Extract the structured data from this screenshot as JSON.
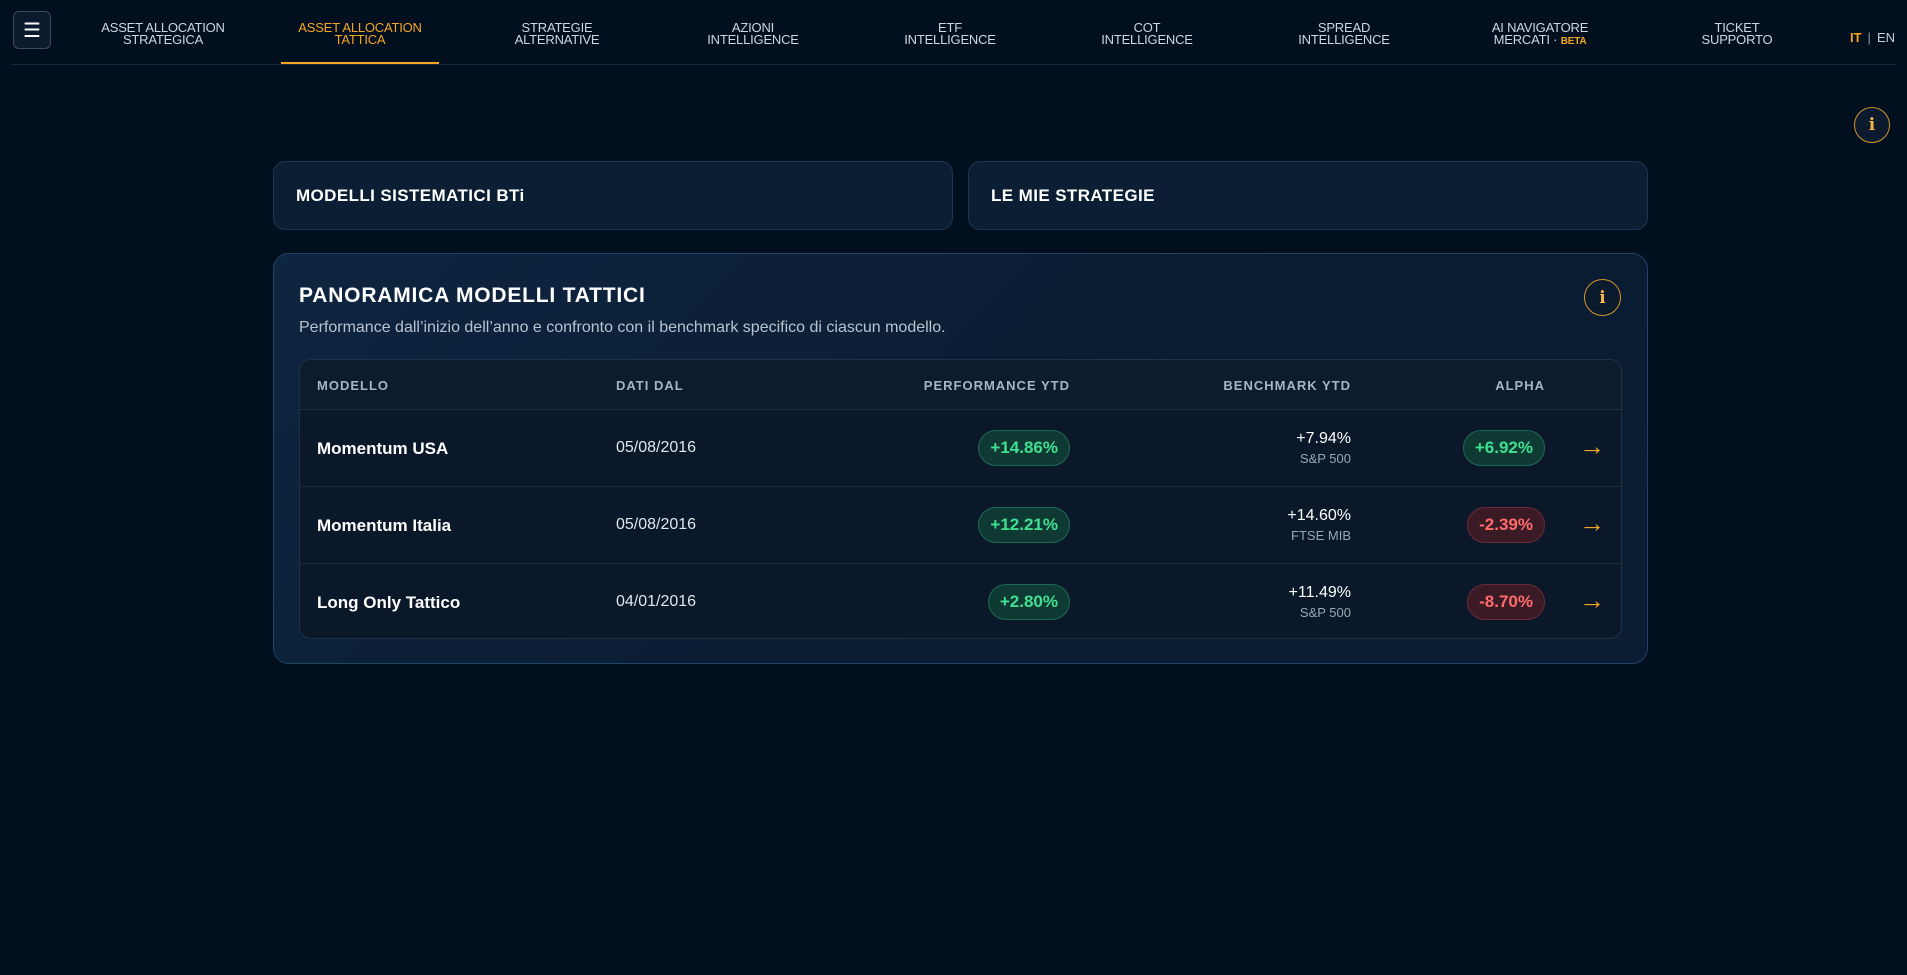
{
  "nav": {
    "menu_icon": "hamburger-icon",
    "items": [
      {
        "line1": "ASSET ALLOCATION",
        "line2": "STRATEGICA",
        "active": false
      },
      {
        "line1": "ASSET ALLOCATION",
        "line2": "TATTICA",
        "active": true
      },
      {
        "line1": "STRATEGIE",
        "line2": "ALTERNATIVE",
        "active": false
      },
      {
        "line1": "AZIONI",
        "line2": "INTELLIGENCE",
        "active": false
      },
      {
        "line1": "ETF",
        "line2": "INTELLIGENCE",
        "active": false
      },
      {
        "line1": "COT",
        "line2": "INTELLIGENCE",
        "active": false
      },
      {
        "line1": "SPREAD",
        "line2": "INTELLIGENCE",
        "active": false
      },
      {
        "line1": "AI NAVIGATORE",
        "line2": "MERCATI ·",
        "badge": "BETA",
        "active": false
      },
      {
        "line1": "TICKET",
        "line2": "SUPPORTO",
        "active": false
      }
    ],
    "lang": {
      "it": "IT",
      "sep": "|",
      "en": "EN"
    }
  },
  "info_icon_glyph": "i",
  "cards": {
    "left": "MODELLI SISTEMATICI BTi",
    "right": "LE MIE STRATEGIE"
  },
  "panel": {
    "title": "PANORAMICA MODELLI TATTICI",
    "subtitle": "Performance dall’inizio dell’anno e confronto con il benchmark specifico di ciascun modello.",
    "columns": {
      "model": "MODELLO",
      "since": "DATI DAL",
      "perf": "PERFORMANCE YTD",
      "bench": "BENCHMARK YTD",
      "alpha": "ALPHA"
    },
    "rows": [
      {
        "model": "Momentum USA",
        "since": "05/08/2016",
        "perf": "+14.86%",
        "bench_value": "+7.94%",
        "bench_name": "S&P 500",
        "alpha": "+6.92%",
        "alpha_sign": "pos",
        "arrow": "→"
      },
      {
        "model": "Momentum Italia",
        "since": "05/08/2016",
        "perf": "+12.21%",
        "bench_value": "+14.60%",
        "bench_name": "FTSE MIB",
        "alpha": "-2.39%",
        "alpha_sign": "neg",
        "arrow": "→"
      },
      {
        "model": "Long Only Tattico",
        "since": "04/01/2016",
        "perf": "+2.80%",
        "bench_value": "+11.49%",
        "bench_name": "S&P 500",
        "alpha": "-8.70%",
        "alpha_sign": "neg",
        "arrow": "→"
      }
    ]
  },
  "colors": {
    "accent": "#f5a623",
    "positive": "#3fe090",
    "negative": "#ff6b6b",
    "background": "#020f1f"
  }
}
